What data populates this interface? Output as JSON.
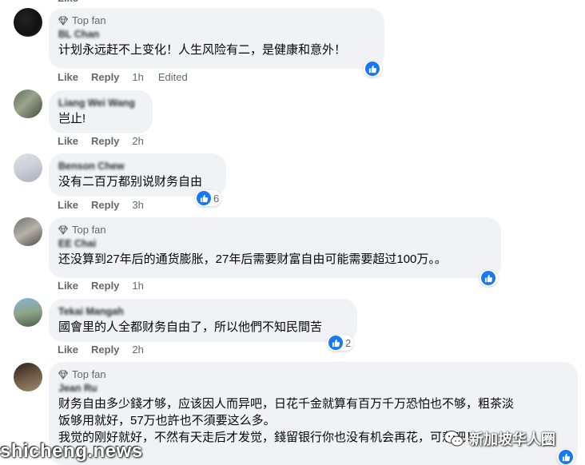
{
  "top_fan_label": "Top fan",
  "like_label": "Like",
  "reply_label": "Reply",
  "comments": [
    {
      "top_fan": true,
      "author": "BL Chan",
      "text": "计划永远赶不上变化！人生风险有二，是健康和意外！",
      "time": "1h",
      "edited": "Edited",
      "reaction_count": ""
    },
    {
      "top_fan": false,
      "author": "Liang Wei Wang",
      "text": "岂止!",
      "time": "2h",
      "edited": "",
      "reaction_count": ""
    },
    {
      "top_fan": false,
      "author": "Benson Chew",
      "text": "没有二百万都别说财务自由",
      "time": "3h",
      "edited": "",
      "reaction_count": "6"
    },
    {
      "top_fan": true,
      "author": "EE Chai",
      "text": "还没算到27年后的通货膨胀，27年后需要财富自由可能需要超过100万。。",
      "time": "1h",
      "edited": "",
      "reaction_count": ""
    },
    {
      "top_fan": false,
      "author": "Tekai Mangah",
      "text": "國會里的人全都财务自由了，所以他們不知民間苦",
      "time": "2h",
      "edited": "",
      "reaction_count": "2"
    },
    {
      "top_fan": true,
      "author": "Jean Ru",
      "text": "财务自由多少錢才够，应该因人而异吧，日花千金就算有百万千万恐怕也不够，粗茶淡\n饭够用就好，57万也許也不須要这么多。\n我觉的刚好就好，不然有天走后才发觉，錢留银行你也没有机会再花，可悲吧！",
      "time": "",
      "edited": "",
      "reaction_count": ""
    }
  ],
  "watermark_left": "shicheng.news",
  "watermark_right": "新加坡华人圈",
  "colors": {
    "bubble": "#f0f2f5",
    "meta": "#65676b",
    "like_blue": "#1877f2"
  }
}
